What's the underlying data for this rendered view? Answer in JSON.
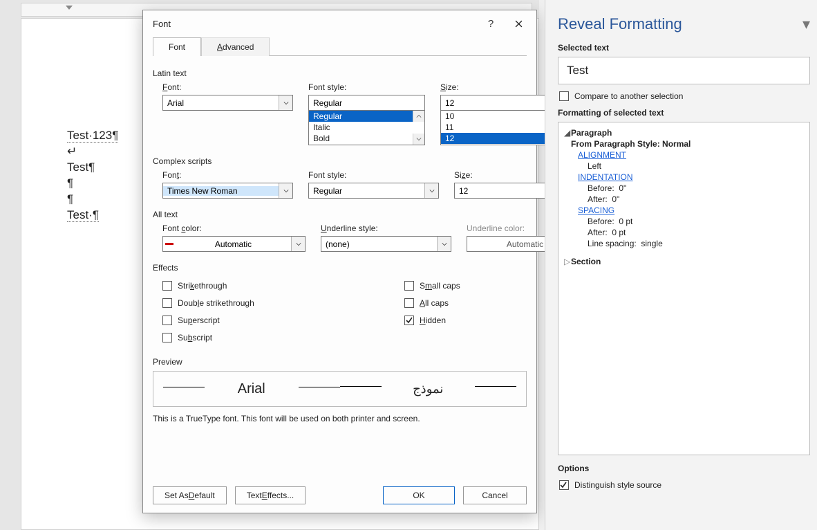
{
  "document": {
    "lines": [
      "Test·123¶",
      "↵",
      "Test¶",
      "¶",
      "¶",
      "Test·¶"
    ]
  },
  "dialog": {
    "title": "Font",
    "help_label": "?",
    "close_label": "✕",
    "tabs": {
      "font": "Font",
      "advanced": "Advanced"
    },
    "latin": {
      "section": "Latin text",
      "font_label": "Font:",
      "font_value": "Arial",
      "style_label": "Font style:",
      "style_value": "Regular",
      "style_options": [
        "Regular",
        "Italic",
        "Bold"
      ],
      "size_label": "Size:",
      "size_value": "12",
      "size_options": [
        "10",
        "11",
        "12"
      ]
    },
    "complex": {
      "section": "Complex scripts",
      "font_label": "Font:",
      "font_value": "Times New Roman",
      "style_label": "Font style:",
      "style_value": "Regular",
      "size_label": "Size:",
      "size_value": "12"
    },
    "alltext": {
      "section": "All text",
      "font_color_label": "Font color:",
      "font_color_value": "Automatic",
      "underline_style_label": "Underline style:",
      "underline_style_value": "(none)",
      "underline_color_label": "Underline color:",
      "underline_color_value": "Automatic"
    },
    "effects": {
      "section": "Effects",
      "strikethrough": "Strikethrough",
      "double_strike": "Double strikethrough",
      "superscript": "Superscript",
      "subscript": "Subscript",
      "small_caps": "Small caps",
      "all_caps": "All caps",
      "hidden": "Hidden",
      "hidden_checked": true
    },
    "preview": {
      "section": "Preview",
      "latin_sample": "Arial",
      "arabic_sample": "نموذج",
      "hint": "This is a TrueType font. This font will be used on both printer and screen."
    },
    "buttons": {
      "set_default": "Set As Default",
      "text_effects": "Text Effects...",
      "ok": "OK",
      "cancel": "Cancel"
    }
  },
  "panel": {
    "title": "Reveal Formatting",
    "selected_text_label": "Selected text",
    "selected_text_value": "Test",
    "compare_label": "Compare to another selection",
    "formatting_label": "Formatting of selected text",
    "tree": {
      "paragraph": "Paragraph",
      "from_style": "From Paragraph Style: Normal",
      "alignment": "ALIGNMENT",
      "alignment_val": "Left",
      "indentation": "INDENTATION",
      "indent_before": "Before:  0\"",
      "indent_after": "After:  0\"",
      "spacing": "SPACING",
      "spacing_before": "Before:  0 pt",
      "spacing_after": "After:  0 pt",
      "line_spacing": "Line spacing:  single",
      "section": "Section"
    },
    "options_label": "Options",
    "distinguish_label": "Distinguish style source"
  }
}
